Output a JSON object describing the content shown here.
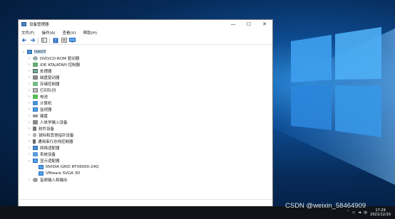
{
  "window": {
    "title": "设备管理器",
    "controls": {
      "minimize": "—",
      "maximize": "☐",
      "close": "✕"
    }
  },
  "menu": [
    "文件(F)",
    "操作(A)",
    "查看(V)",
    "帮助(H)"
  ],
  "toolbar": [
    "back-icon",
    "forward-icon",
    "show-hide-icon",
    "help-icon",
    "properties-icon",
    "monitor-icon"
  ],
  "tree": {
    "root": "lisb03",
    "categories": [
      "DVD/CD-ROM 驱动器",
      "IDE ATA/ATAPI 控制器",
      "处理器",
      "磁盘驱动器",
      "存储控制器",
      "打印队列",
      "电池",
      "计算机",
      "监视器",
      "键盘",
      "人体学输入设备",
      "软件设备",
      "鼠标和其他指针设备",
      "通用串行总线控制器",
      "网络适配器",
      "系统设备",
      "显示适配器"
    ],
    "display_adapters": [
      "NVIDIA GRID RTX6000-24Q",
      "VMware SVGA 3D"
    ],
    "last": "音频输入和输出"
  },
  "taskbar": {
    "tray_icons": [
      "chevron-up-icon",
      "network-icon",
      "speaker-icon",
      "ime-icon"
    ],
    "ime": "中",
    "time": "17:29",
    "date": "2021/12/10"
  },
  "watermark": "CSDN @weixin_58464909"
}
